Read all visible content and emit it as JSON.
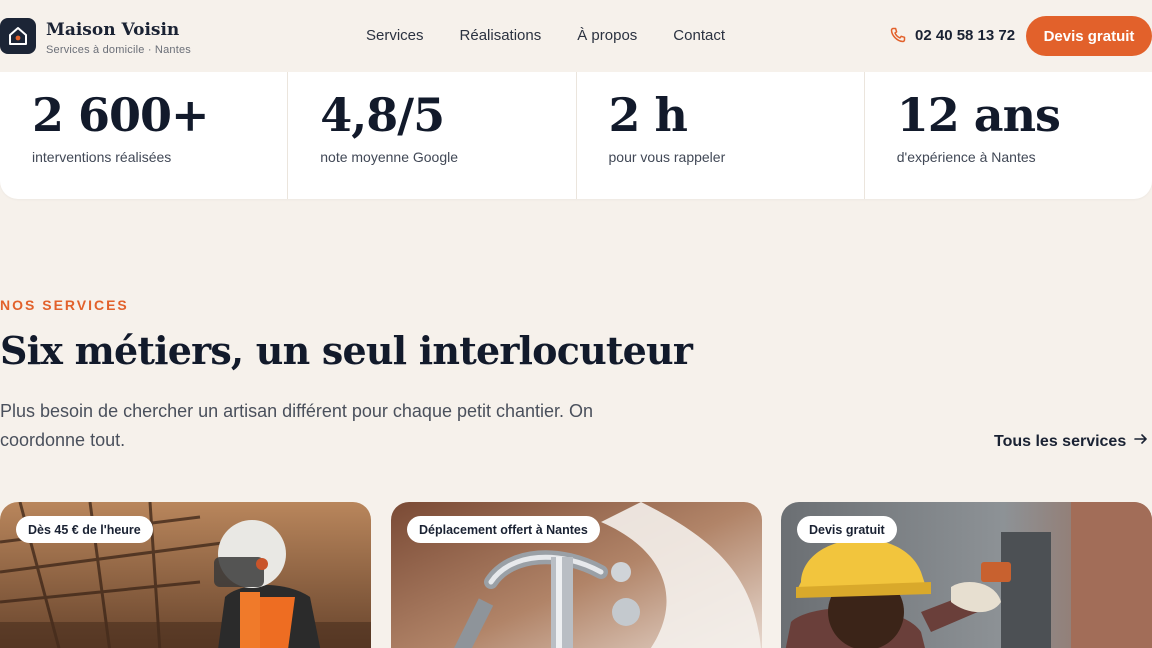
{
  "brand": {
    "name": "Maison Voisin",
    "tagline": "Services à domicile · Nantes",
    "logo_icon": "house-icon"
  },
  "nav": {
    "items": [
      "Services",
      "Réalisations",
      "À propos",
      "Contact"
    ]
  },
  "header": {
    "phone": "02 40 58 13 72",
    "phone_icon": "phone-icon",
    "cta_label": "Devis gratuit"
  },
  "stats": [
    {
      "value": "2 600+",
      "label": "interventions réalisées"
    },
    {
      "value": "4,8/5",
      "label": "note moyenne Google"
    },
    {
      "value": "2 h",
      "label": "pour vous rappeler"
    },
    {
      "value": "12 ans",
      "label": "d'expérience à Nantes"
    }
  ],
  "services": {
    "eyebrow": "NOS SERVICES",
    "title": "Six métiers, un seul interlocuteur",
    "description": "Plus besoin de chercher un artisan différent pour chaque petit chantier. On coordonne tout.",
    "all_link": "Tous les services",
    "all_link_icon": "arrow-right-icon"
  },
  "cards": [
    {
      "badge": "Dès 45 € de l'heure",
      "image": "worker-welding-photo"
    },
    {
      "badge": "Déplacement offert à Nantes",
      "image": "plumbing-faucet-photo"
    },
    {
      "badge": "Devis gratuit",
      "image": "electrician-hardhat-photo"
    }
  ],
  "colors": {
    "accent": "#e2612b",
    "dark": "#1c2536",
    "background": "#f6f1eb"
  }
}
